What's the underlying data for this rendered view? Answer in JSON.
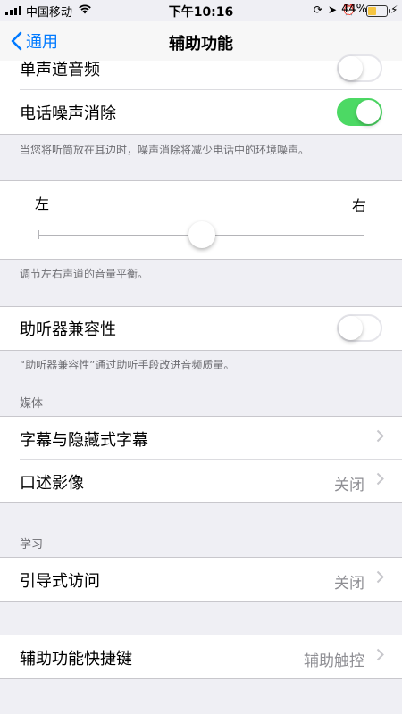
{
  "status_bar": {
    "carrier": "中国移动",
    "time": "下午10:16",
    "battery_percent": "44%",
    "battery_level": 0.44,
    "icons": [
      "signal-icon",
      "wifi-icon",
      "lock-rotation-icon",
      "location-icon",
      "alarm-icon",
      "battery-icon",
      "charging-bolt-icon"
    ]
  },
  "nav": {
    "back_label": "通用",
    "title": "辅助功能"
  },
  "audio": {
    "mono_audio_label": "单声道音频",
    "mono_audio_on": false,
    "noise_cancel_label": "电话噪声消除",
    "noise_cancel_on": true,
    "noise_cancel_note": "当您将听筒放在耳边时，噪声消除将减少电话中的环境噪声。"
  },
  "balance": {
    "left_label": "左",
    "right_label": "右",
    "value": 0.5,
    "note": "调节左右声道的音量平衡。"
  },
  "hearing": {
    "label": "助听器兼容性",
    "on": false,
    "note": "“助听器兼容性”通过助听手段改进音频质量。"
  },
  "media": {
    "header": "媒体",
    "subtitles_label": "字幕与隐藏式字幕",
    "audio_desc_label": "口述影像",
    "audio_desc_value": "关闭"
  },
  "learning": {
    "header": "学习",
    "guided_access_label": "引导式访问",
    "guided_access_value": "关闭"
  },
  "shortcut": {
    "label": "辅助功能快捷键",
    "value": "辅助触控"
  },
  "colors": {
    "accent": "#007aff",
    "switch_on": "#4cd964",
    "background": "#efeff4",
    "battery": "#f5c542"
  }
}
